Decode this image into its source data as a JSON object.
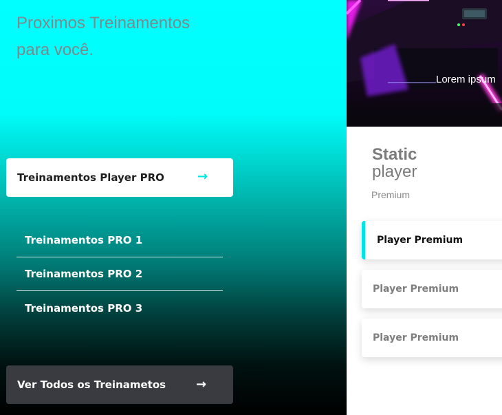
{
  "left": {
    "headline": "Proximos Treinamentos para você.",
    "cta": {
      "label": "Treinamentos Player PRO",
      "arrow_icon": "arrow-right-icon",
      "arrow_color": "#00e5e5"
    },
    "items": [
      {
        "label": "Treinamentos PRO 1"
      },
      {
        "label": "Treinamentos PRO 2"
      },
      {
        "label": "Treinamentos PRO 3"
      }
    ],
    "all_button": {
      "label": "Ver Todos os Treinametos",
      "arrow_icon": "arrow-right-icon"
    },
    "gradient": {
      "top_color": "#00ffff",
      "bottom_color": "#000000"
    }
  },
  "right": {
    "hero": {
      "caption": "Lorem ipsum"
    },
    "title_line1": "Static",
    "title_line2": "player",
    "subtitle": "Premium",
    "cards": [
      {
        "label": "Player Premium",
        "active": true
      },
      {
        "label": "Player Premium",
        "active": false
      },
      {
        "label": "Player Premium",
        "active": false
      }
    ],
    "accent_color": "#00e5e5"
  }
}
